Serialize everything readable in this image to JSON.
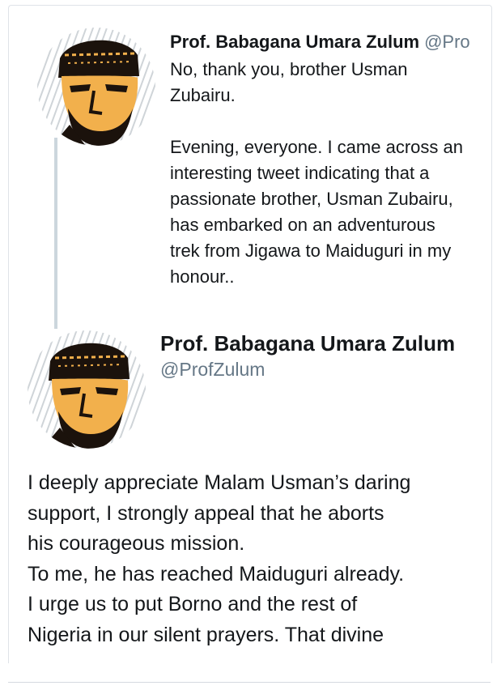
{
  "quoted_tweet": {
    "author_name": "Prof. Babagana Umara Zulum",
    "author_handle": "@Pro",
    "paragraphs": [
      "No, thank you, brother Usman Zubairu.",
      "Evening, everyone. I came across an interesting tweet indicating that a passionate brother, Usman Zubairu, has embarked on an adventurous trek from Jigawa to Maiduguri in my honour.."
    ]
  },
  "main_tweet": {
    "author_name": "Prof. Babagana Umara Zulum",
    "author_handle": "@ProfZulum",
    "lines": [
      "I deeply appreciate Malam Usman’s daring",
      "support, I strongly appeal that he aborts",
      "his courageous mission.",
      "To me, he has reached Maiduguri already.",
      "I urge us to put Borno and the rest of",
      "Nigeria in our silent prayers. That divine"
    ]
  },
  "colors": {
    "text": "#14171a",
    "secondary_text": "#657786",
    "thread_line": "#ccd6dd",
    "avatar_accent": "#f2b04c"
  },
  "icons": {
    "avatar": "profile-photo-illustration"
  }
}
